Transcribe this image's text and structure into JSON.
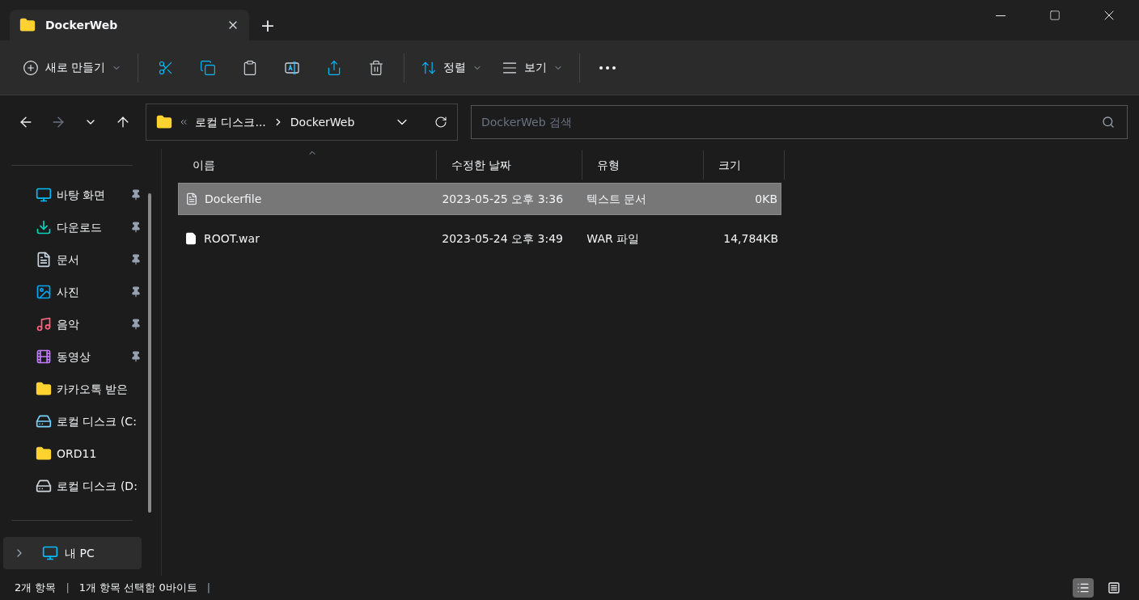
{
  "window": {
    "tab": {
      "title": "DockerWeb"
    },
    "new_tab": "+"
  },
  "toolbar": [
    {
      "kind": "new",
      "label": "새로 만들기"
    },
    {
      "kind": "cut"
    },
    {
      "kind": "copy"
    },
    {
      "kind": "paste"
    },
    {
      "kind": "rename"
    },
    {
      "kind": "share"
    },
    {
      "kind": "delete"
    },
    {
      "kind": "sort",
      "label": "정렬"
    },
    {
      "kind": "view",
      "label": "보기"
    },
    {
      "kind": "more"
    }
  ],
  "address": {
    "path": [
      {
        "label": "로컬 디스크..."
      },
      {
        "label": "DockerWeb"
      }
    ],
    "search_placeholder": "DockerWeb 검색"
  },
  "sidebar": {
    "items": [
      {
        "kind": "desktop",
        "label": "바탕 화면",
        "pinned": true
      },
      {
        "kind": "download",
        "label": "다운로드",
        "pinned": true
      },
      {
        "kind": "document",
        "label": "문서",
        "pinned": true
      },
      {
        "kind": "picture",
        "label": "사진",
        "pinned": true
      },
      {
        "kind": "music",
        "label": "음악",
        "pinned": true
      },
      {
        "kind": "video",
        "label": "동영상",
        "pinned": true
      },
      {
        "kind": "folder",
        "label": "카카오톡 받은",
        "pinned": false
      },
      {
        "kind": "system-drive",
        "label": "로컬 디스크 (C:",
        "pinned": false
      },
      {
        "kind": "folder",
        "label": "ORD11",
        "pinned": false
      },
      {
        "kind": "drive",
        "label": "로컬 디스크 (D:",
        "pinned": false
      }
    ],
    "this_pc": {
      "label": "내 PC",
      "expanded": false,
      "selected": true
    }
  },
  "table": {
    "columns": [
      {
        "label": "이름",
        "sorted": true
      },
      {
        "label": "수정한 날짜",
        "sorted": false
      },
      {
        "label": "유형",
        "sorted": false
      },
      {
        "label": "크기",
        "sorted": false
      }
    ],
    "rows": [
      {
        "kind": "text",
        "name": "Dockerfile",
        "date": "2023-05-25 오후 3:36",
        "type": "텍스트 문서",
        "size": "0KB",
        "selected": true
      },
      {
        "kind": "file",
        "name": "ROOT.war",
        "date": "2023-05-24 오후 3:49",
        "type": "WAR 파일",
        "size": "14,784KB",
        "selected": false
      }
    ]
  },
  "status_bar": {
    "items": [
      {
        "kind": "text",
        "text": "2개 항목"
      },
      {
        "kind": "separator",
        "text": "|"
      },
      {
        "kind": "text",
        "text": "1개 항목 선택함 0바이트"
      },
      {
        "kind": "separator",
        "text": "|"
      }
    ],
    "views": [
      {
        "kind": "details",
        "selected": true
      },
      {
        "kind": "tiles",
        "selected": false
      }
    ]
  }
}
